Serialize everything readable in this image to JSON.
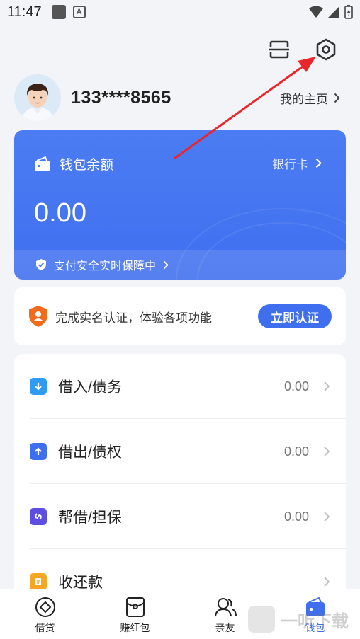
{
  "status_bar": {
    "time": "11:47",
    "letter_icon": "A"
  },
  "profile": {
    "phone": "133****8565",
    "homepage_label": "我的主页"
  },
  "wallet": {
    "title": "钱包余额",
    "bank_card_label": "银行卡",
    "balance": "0.00",
    "security_text": "支付安全实时保障中"
  },
  "verify": {
    "text": "完成实名认证，体验各项功能",
    "button_label": "立即认证"
  },
  "list": [
    {
      "label": "借入/债务",
      "value": "0.00",
      "icon": "arrow-down-icon",
      "color": "#2f9bf5"
    },
    {
      "label": "借出/债权",
      "value": "0.00",
      "icon": "arrow-up-icon",
      "color": "#3f6fee"
    },
    {
      "label": "帮借/担保",
      "value": "0.00",
      "icon": "link-icon",
      "color": "#5b4ee0"
    },
    {
      "label": "收还款",
      "value": "",
      "icon": "document-icon",
      "color": "#f5a623"
    }
  ],
  "tabs": [
    {
      "label": "借贷",
      "icon": "diamond-icon"
    },
    {
      "label": "赚红包",
      "icon": "red-packet-icon"
    },
    {
      "label": "亲友",
      "icon": "friends-icon"
    },
    {
      "label": "钱包",
      "icon": "wallet-icon",
      "active": true
    }
  ],
  "watermark": {
    "text": "一听下载"
  },
  "colors": {
    "primary": "#3f6fee",
    "background": "#f3f4f8",
    "annotation_arrow": "#e8262b"
  }
}
